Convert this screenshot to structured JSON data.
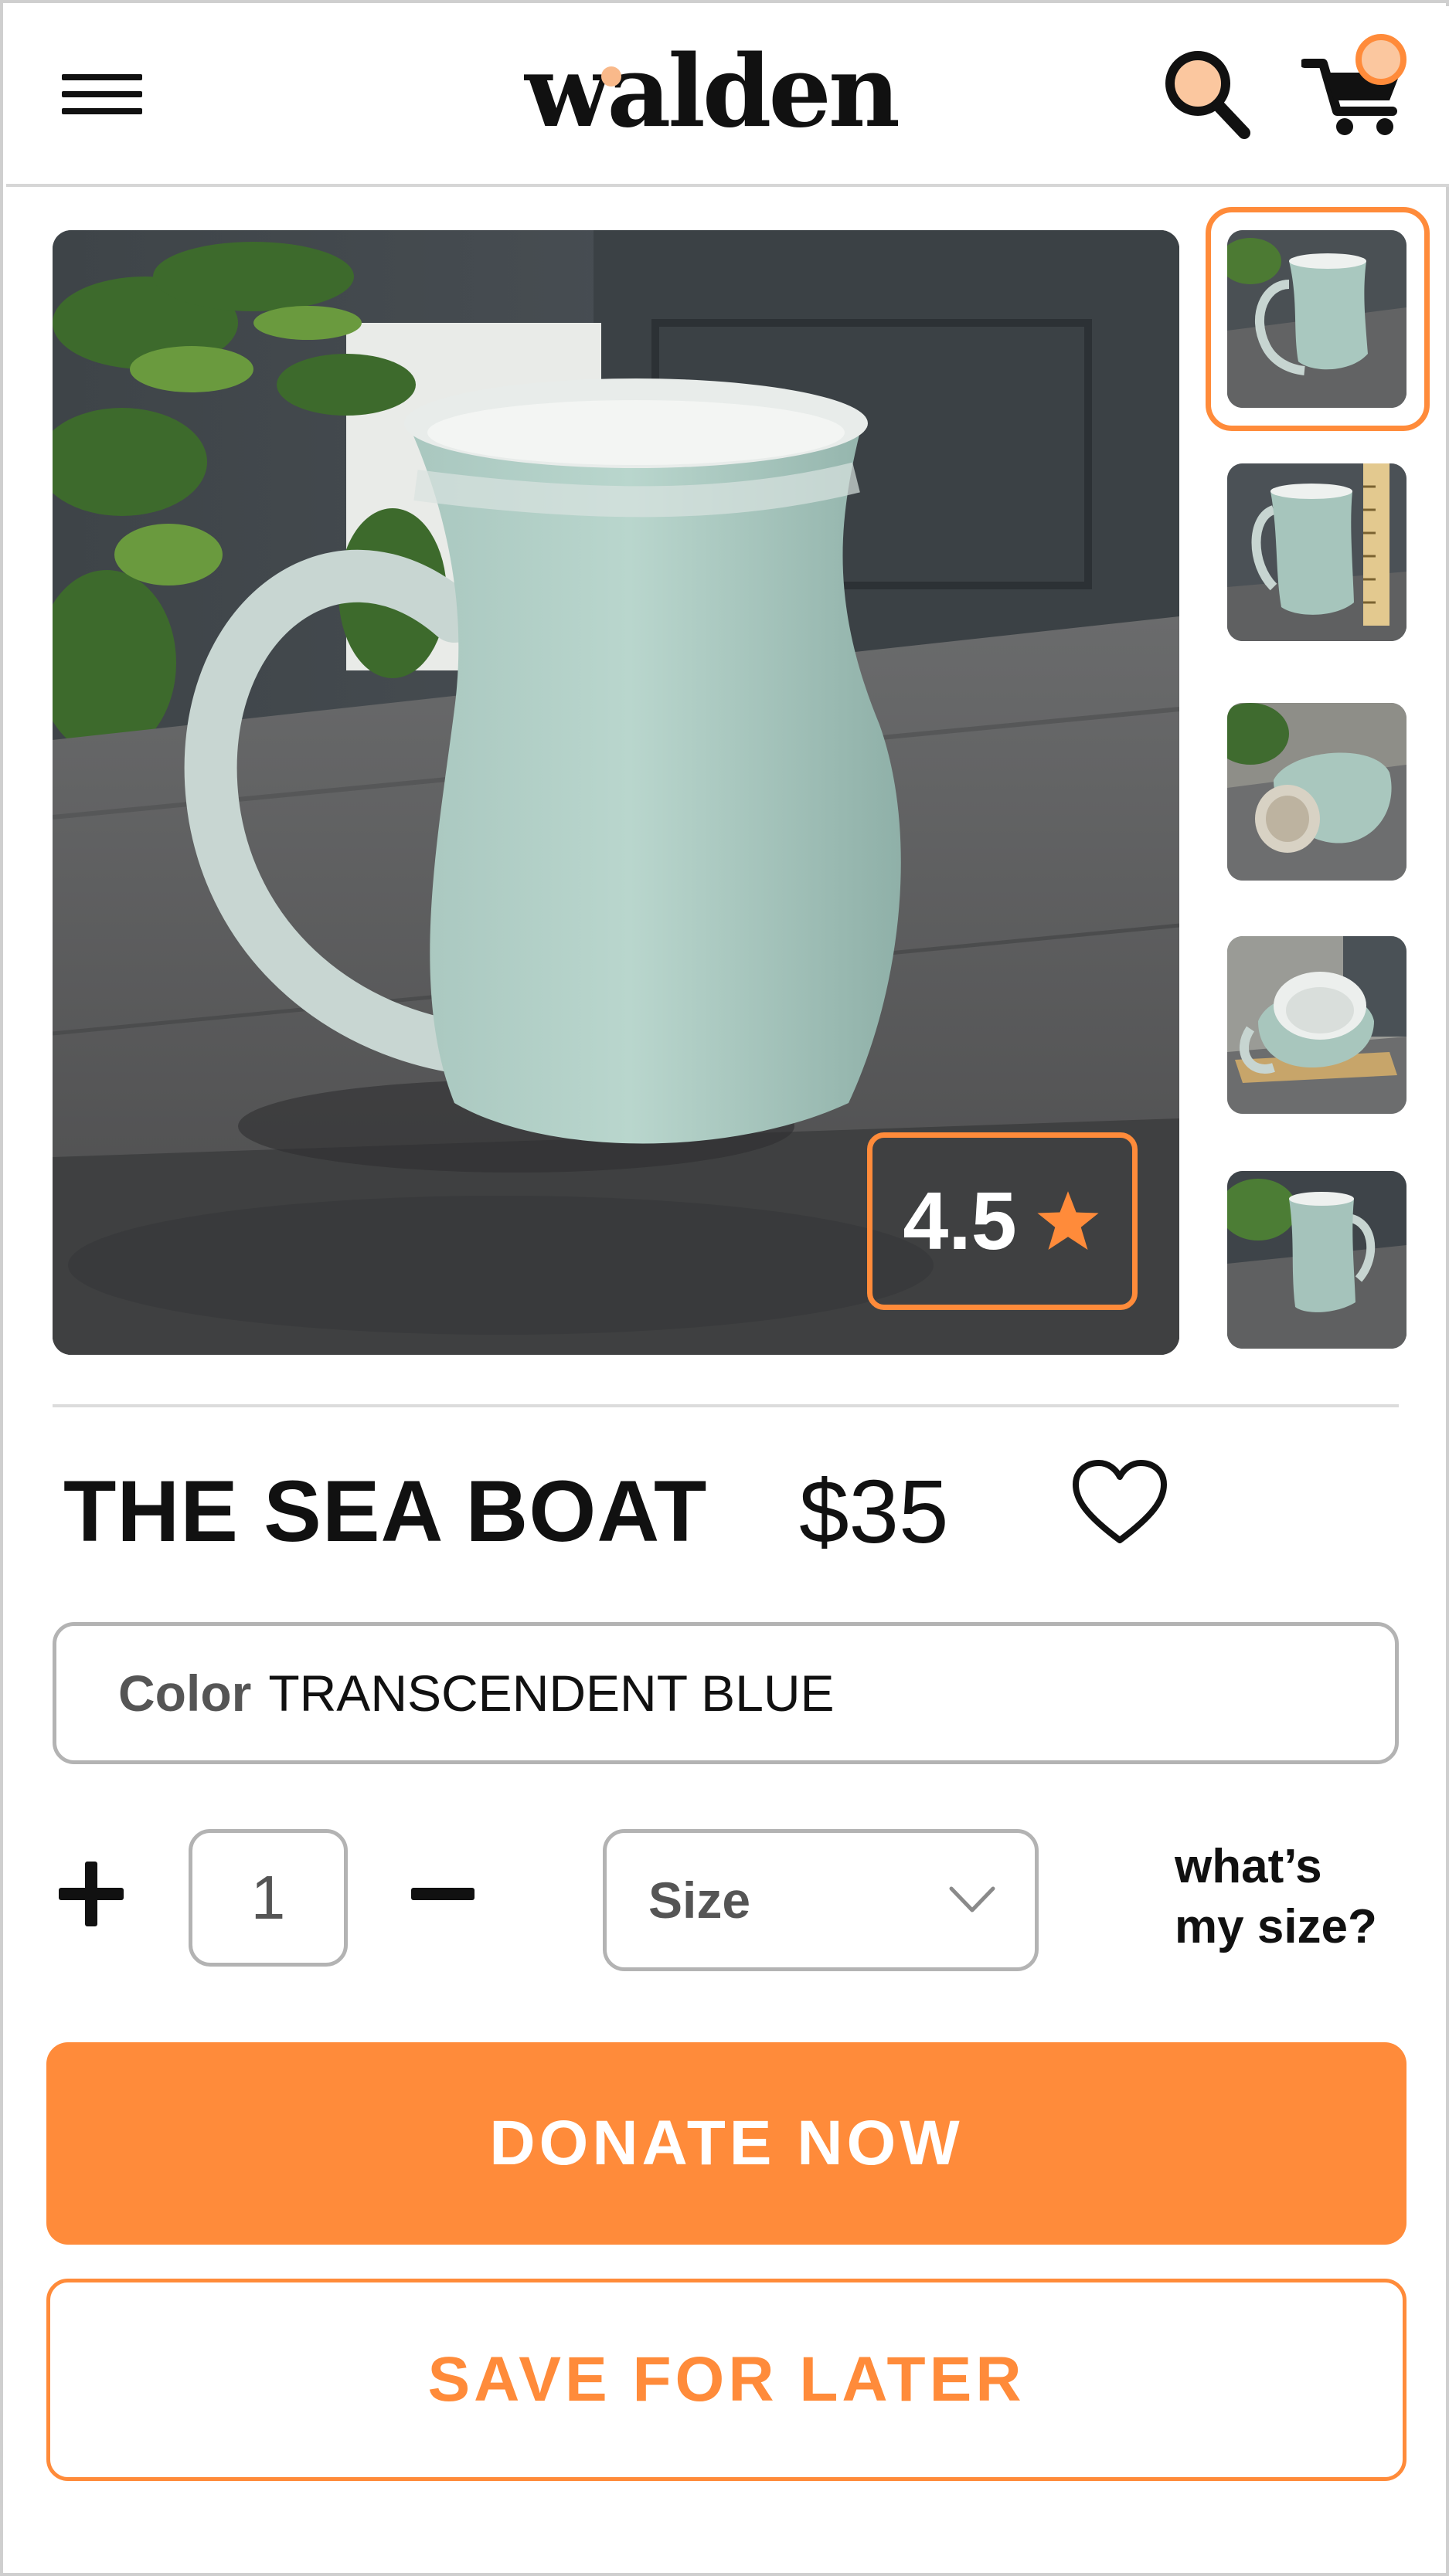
{
  "header": {
    "logo_text": "walden",
    "menu_icon": "hamburger-menu-icon",
    "search_icon": "search-icon",
    "cart_icon": "shopping-cart-icon"
  },
  "gallery": {
    "main_image": "grey-green speckled ceramic mug on a weathered wooden bench",
    "rating": "4.5",
    "rating_icon": "star-icon",
    "thumbnails": [
      {
        "description": "mug on bench, angled view",
        "selected": true
      },
      {
        "description": "mug next to a ruler"
      },
      {
        "description": "mug lying on its side showing the base"
      },
      {
        "description": "mug upside down on a wooden stand"
      },
      {
        "description": "mug on bench, front view"
      }
    ]
  },
  "product": {
    "name": "THE SEA BOAT",
    "price": "$35",
    "favorite_icon": "heart-outline-icon"
  },
  "color": {
    "label": "Color",
    "value": "TRANSCENDENT BLUE"
  },
  "quantity": {
    "value": "1",
    "increment_icon": "plus-icon",
    "decrement_icon": "minus-icon"
  },
  "size": {
    "placeholder": "Size",
    "chevron_icon": "chevron-down-icon",
    "help_line1": "what’s",
    "help_line2": "my size?"
  },
  "actions": {
    "primary_label": "DONATE NOW",
    "secondary_label": "SAVE FOR LATER"
  },
  "colors": {
    "accent": "#ff8b3a",
    "accent_light": "#fbc79f",
    "text": "#111111",
    "border": "#b3b3b3"
  }
}
